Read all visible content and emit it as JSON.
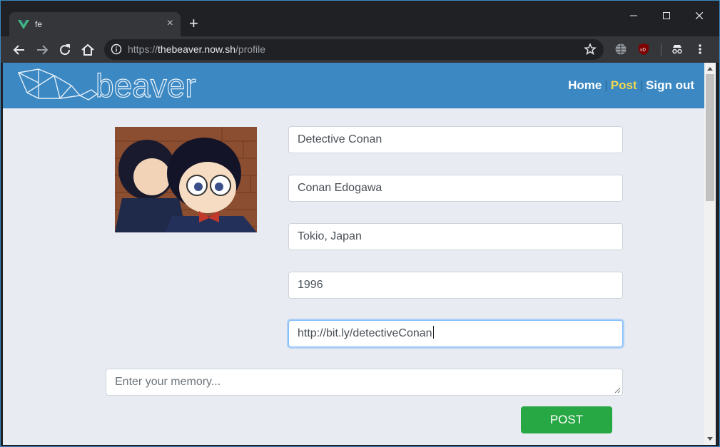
{
  "browser": {
    "tab_title": "fe",
    "tab_close": "×",
    "new_tab": "+",
    "url_scheme": "https://",
    "url_host": "thebeaver.now.sh",
    "url_path": "/profile",
    "favicon": "vue-logo-icon",
    "extensions": [
      "globe-icon",
      "ublock-icon",
      "incognito-icon",
      "menu-dots-icon"
    ]
  },
  "header": {
    "logo_text": "beaver",
    "nav": [
      {
        "label": "Home",
        "active": false
      },
      {
        "label": "Post",
        "active": true
      },
      {
        "label": "Sign out",
        "active": false
      }
    ],
    "separator": "|"
  },
  "profile": {
    "avatar_alt": "avatar",
    "fields": [
      {
        "name": "title-field",
        "value": "Detective Conan"
      },
      {
        "name": "name-field",
        "value": "Conan Edogawa"
      },
      {
        "name": "location-field",
        "value": "Tokio, Japan"
      },
      {
        "name": "year-field",
        "value": "1996"
      },
      {
        "name": "link-field",
        "value": "http://bit.ly/detectiveConan"
      }
    ]
  },
  "memory": {
    "placeholder": "Enter your memory..."
  },
  "post_button": "POST",
  "colors": {
    "header": "#3b88c3",
    "page_bg": "#e9ebf2",
    "nav_active": "#f2d94b",
    "button": "#28a745"
  }
}
